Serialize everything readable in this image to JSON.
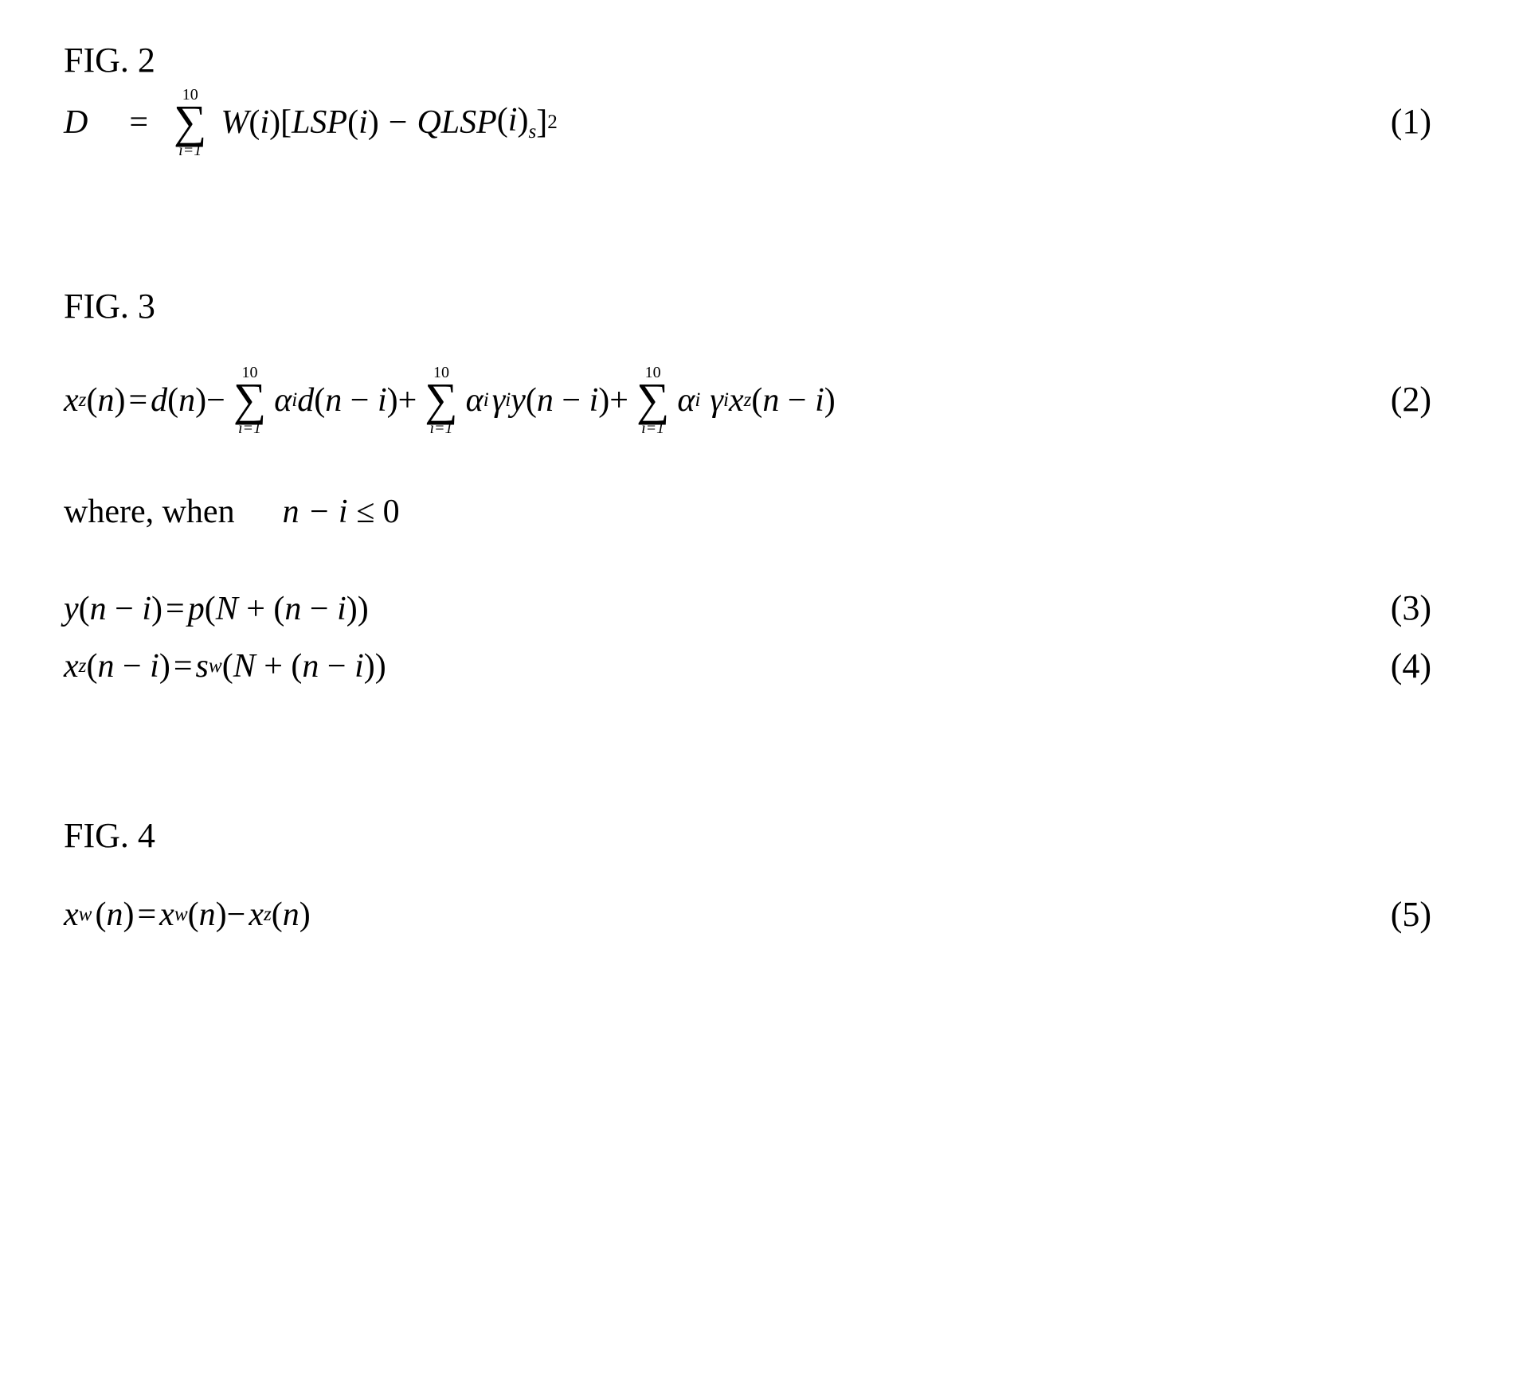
{
  "fig2": {
    "label": "FIG. 2",
    "lhs": "D",
    "eq_sign": "=",
    "sum_lower": "i=1",
    "sum_upper": "10",
    "W": "W",
    "i_arg": "(i)",
    "LSP": "LSP",
    "minus": "−",
    "QLSP": "QLSP",
    "sub_s": "s",
    "sq_exp": "2",
    "eq_num": "(1)"
  },
  "fig3": {
    "label": "FIG. 3",
    "x": "x",
    "z": "z",
    "n_arg": "(n)",
    "eq_sign": "=",
    "d": "d",
    "minus": "−",
    "plus": "+",
    "sum_lower": "i=1",
    "sum_upper": "10",
    "alpha": "α",
    "i_sub": "i",
    "gamma": "γ",
    "i_sup": "i",
    "y": "y",
    "nmi_arg": "(n − i)",
    "eq_num": "(2)",
    "where_text": "where, when",
    "cond": "n − i ≤ 0",
    "p": "p",
    "N_arg_open": "(N + (n − i))",
    "s": "s",
    "w": "w",
    "eq3_num": "(3)",
    "eq4_num": "(4)"
  },
  "fig4": {
    "label": "FIG. 4",
    "x": "x",
    "w": "w",
    "z": "z",
    "n_arg": "(n)",
    "eq_sign": "=",
    "minus": "−",
    "eq_num": "(5)"
  }
}
